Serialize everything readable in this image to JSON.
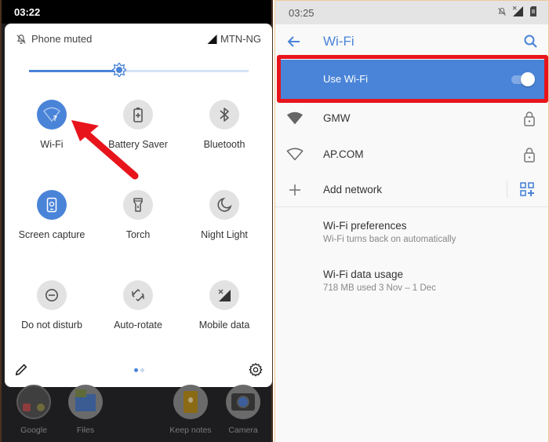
{
  "left": {
    "status_time": "03:22",
    "header": {
      "status_text": "Phone muted",
      "status_icon": "bell-off-icon",
      "carrier": "MTN-NG",
      "signal_icon": "signal-icon"
    },
    "brightness": {
      "value": 0.41,
      "accent": "#4a84d8"
    },
    "tiles": [
      {
        "label": "Wi-Fi",
        "icon": "wifi-unknown-icon",
        "active": true
      },
      {
        "label": "Battery Saver",
        "icon": "battery-saver-icon",
        "active": false
      },
      {
        "label": "Bluetooth",
        "icon": "bluetooth-icon",
        "active": false
      },
      {
        "label": "Screen capture",
        "icon": "screen-capture-icon",
        "active": true
      },
      {
        "label": "Torch",
        "icon": "torch-icon",
        "active": false
      },
      {
        "label": "Night Light",
        "icon": "night-light-icon",
        "active": false
      },
      {
        "label": "Do not disturb",
        "icon": "do-not-disturb-icon",
        "active": false
      },
      {
        "label": "Auto-rotate",
        "icon": "auto-rotate-icon",
        "active": false
      },
      {
        "label": "Mobile data",
        "icon": "mobile-data-icon",
        "active": false
      }
    ],
    "footer": {
      "edit_icon": "pencil-icon",
      "page_count": 2,
      "current_page": 1,
      "settings_icon": "gear-icon"
    },
    "home_apps": [
      {
        "label": "Google"
      },
      {
        "label": "Files"
      },
      {
        "label": "Keep notes"
      },
      {
        "label": "Camera"
      }
    ],
    "annotation": {
      "type": "arrow",
      "color": "#e8141c",
      "points_to": "Wi-Fi"
    }
  },
  "right": {
    "status_time": "03:25",
    "status_icons": [
      "bell-off-icon",
      "no-signal-icon",
      "no-sim-icon"
    ],
    "appbar": {
      "title": "Wi-Fi",
      "back_icon": "arrow-back-icon",
      "search_icon": "search-icon"
    },
    "use_wifi": {
      "label": "Use Wi-Fi",
      "enabled": true,
      "highlight_color": "#e8141c",
      "bg": "#4a84d8"
    },
    "networks": [
      {
        "name": "GMW",
        "icon": "wifi-full-icon",
        "locked": true
      },
      {
        "name": "AP.COM",
        "icon": "wifi-empty-icon",
        "locked": true
      }
    ],
    "add_network": {
      "label": "Add network",
      "icon": "plus-icon",
      "qr_icon": "qr-code-scan-icon"
    },
    "preferences": [
      {
        "title": "Wi-Fi preferences",
        "subtitle": "Wi-Fi turns back on automatically"
      },
      {
        "title": "Wi-Fi data usage",
        "subtitle": "718 MB used 3 Nov – 1 Dec"
      }
    ]
  }
}
